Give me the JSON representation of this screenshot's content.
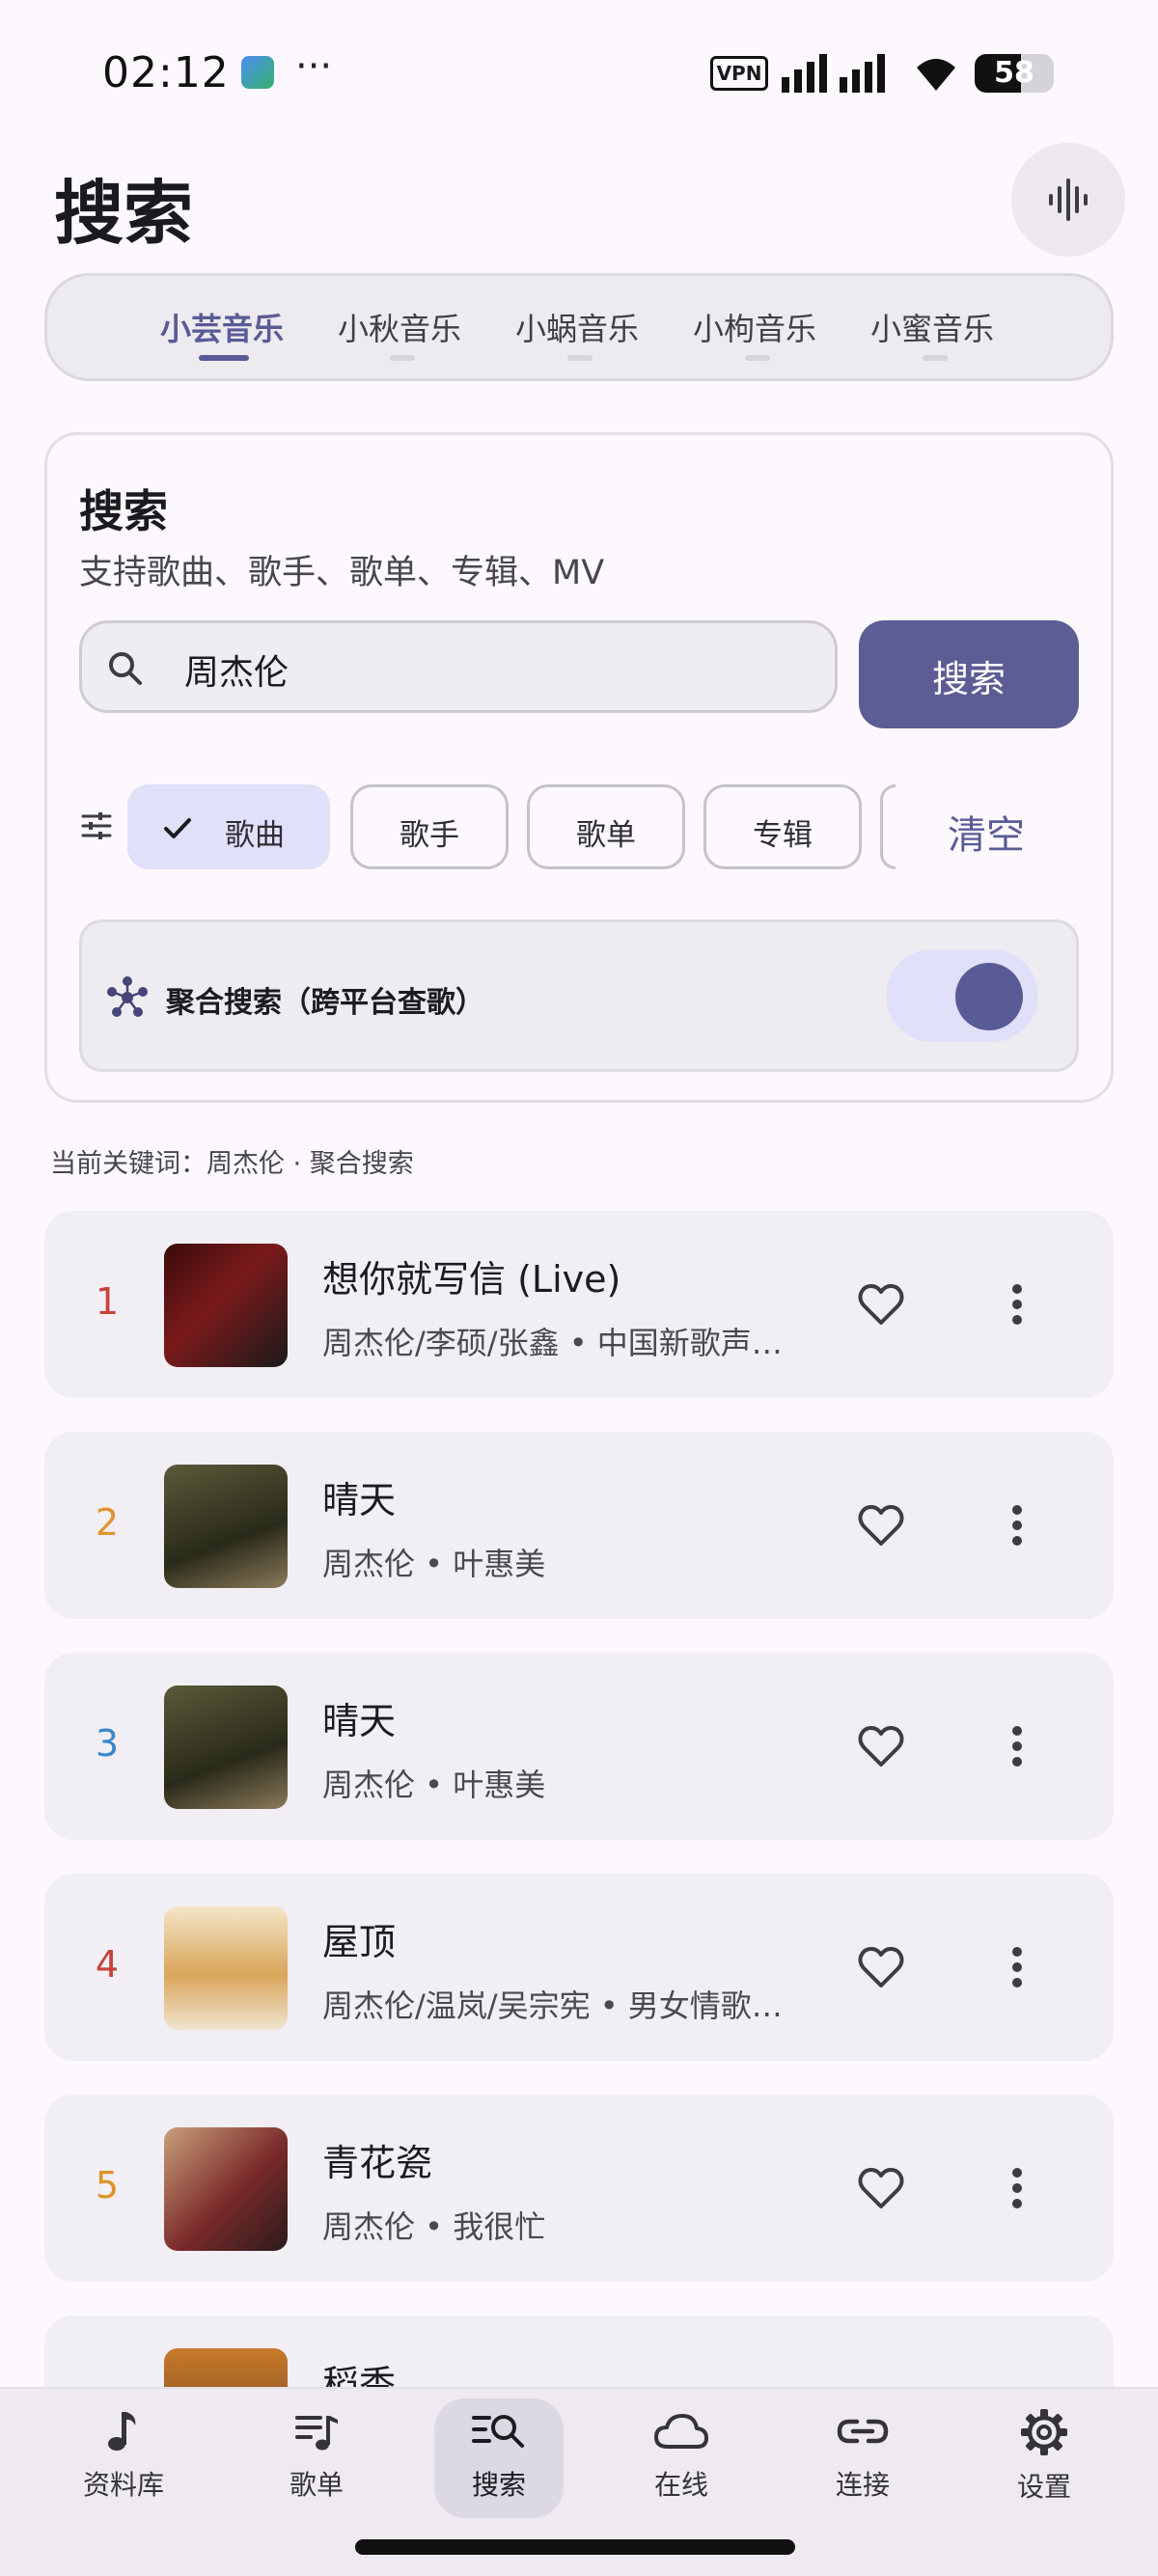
{
  "status_bar": {
    "time": "02:12",
    "more": "···",
    "vpn": "VPN",
    "battery": "58"
  },
  "header": {
    "title": "搜索"
  },
  "platform_tabs": [
    {
      "label": "小芸音乐",
      "active": true
    },
    {
      "label": "小秋音乐",
      "active": false
    },
    {
      "label": "小蜗音乐",
      "active": false
    },
    {
      "label": "小枸音乐",
      "active": false
    },
    {
      "label": "小蜜音乐",
      "active": false
    }
  ],
  "search_card": {
    "title": "搜索",
    "subtitle": "支持歌曲、歌手、歌单、专辑、MV",
    "query": "周杰伦",
    "search_button": "搜索",
    "chips": [
      "歌曲",
      "歌手",
      "歌单",
      "专辑"
    ],
    "selected_chip": "歌曲",
    "clear_button": "清空",
    "aggregate_label": "聚合搜索（跨平台查歌）",
    "aggregate_enabled": true
  },
  "keyword_line": "当前关键词：周杰伦 · 聚合搜索",
  "results": [
    {
      "rank": "1",
      "title": "想你就写信 (Live)",
      "subtitle": "周杰伦/李硕/张鑫 • 中国新歌声…",
      "rank_color": "#c8423a"
    },
    {
      "rank": "2",
      "title": "晴天",
      "subtitle": "周杰伦 • 叶惠美",
      "rank_color": "#e0922b"
    },
    {
      "rank": "3",
      "title": "晴天",
      "subtitle": "周杰伦 • 叶惠美",
      "rank_color": "#3a86c8"
    },
    {
      "rank": "4",
      "title": "屋顶",
      "subtitle": "周杰伦/温岚/吴宗宪 • 男女情歌…",
      "rank_color": "#c8423a"
    },
    {
      "rank": "5",
      "title": "青花瓷",
      "subtitle": "周杰伦 • 我很忙",
      "rank_color": "#e0922b"
    },
    {
      "rank": "",
      "title": "稻香",
      "subtitle": "",
      "rank_color": "#3a86c8"
    }
  ],
  "bottom_nav": [
    {
      "label": "资料库",
      "icon": "music-note-icon"
    },
    {
      "label": "歌单",
      "icon": "playlist-icon"
    },
    {
      "label": "搜索",
      "icon": "search-list-icon",
      "active": true
    },
    {
      "label": "在线",
      "icon": "cloud-icon"
    },
    {
      "label": "连接",
      "icon": "link-icon"
    },
    {
      "label": "设置",
      "icon": "gear-icon"
    }
  ]
}
